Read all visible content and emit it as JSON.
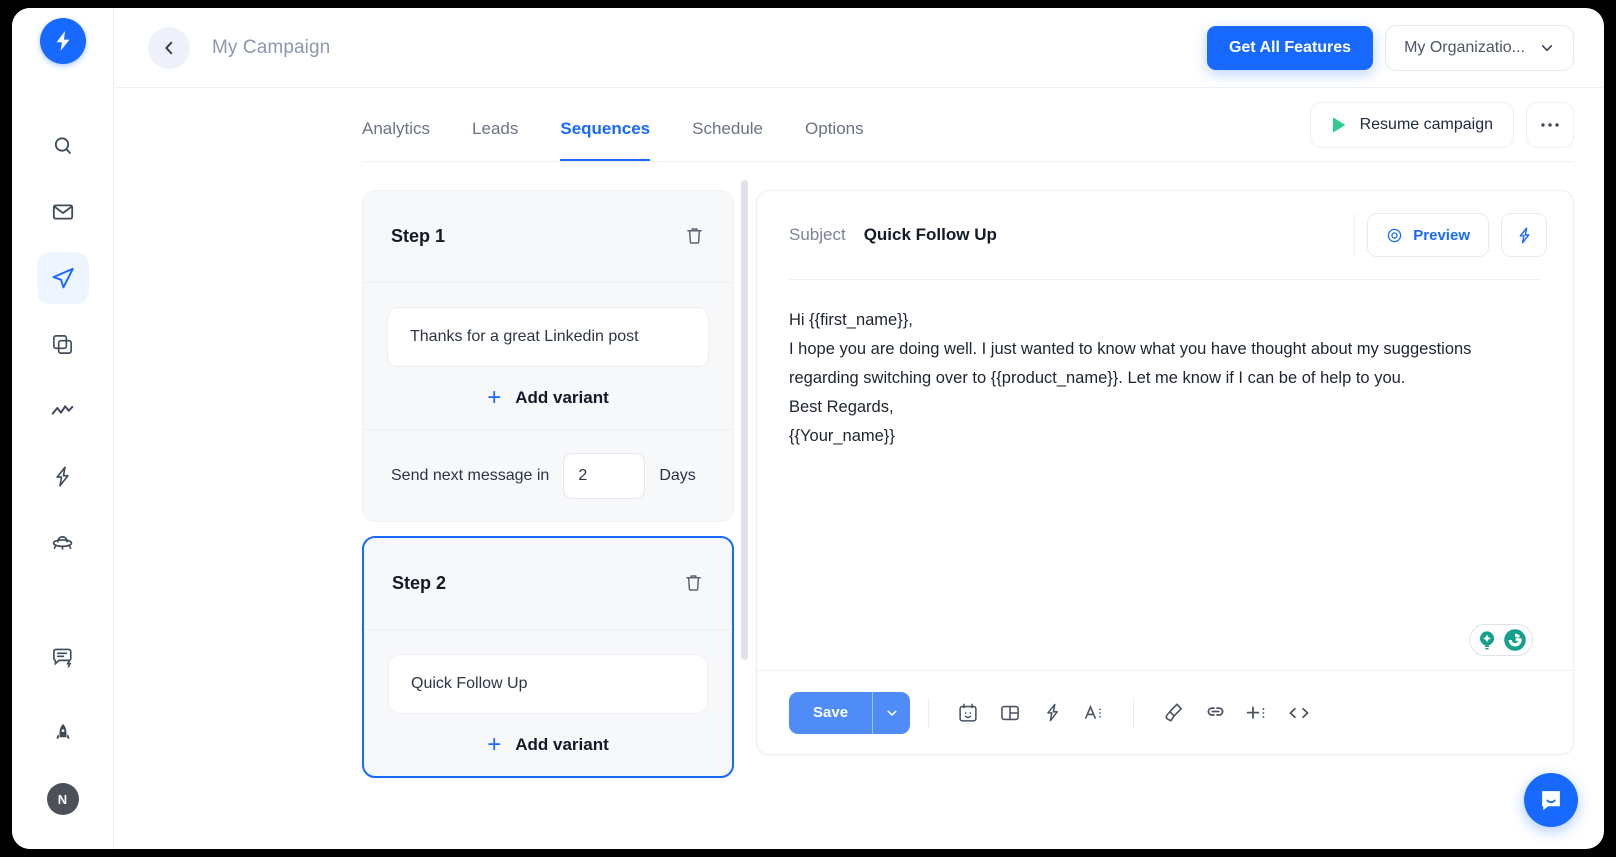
{
  "sidebar": {
    "logo_icon": "lightning-bolt-logo",
    "items": [
      {
        "icon": "search-icon",
        "name": "search",
        "active": false
      },
      {
        "icon": "mail-icon",
        "name": "inbox",
        "active": false
      },
      {
        "icon": "paper-plane-icon",
        "name": "campaigns",
        "active": true
      },
      {
        "icon": "copy-stack-icon",
        "name": "templates",
        "active": false
      },
      {
        "icon": "analytics-line-icon",
        "name": "analytics",
        "active": false
      },
      {
        "icon": "lightning-icon",
        "name": "automations",
        "active": false
      },
      {
        "icon": "ufo-icon",
        "name": "leads-finder",
        "active": false
      }
    ],
    "bottom_items": [
      {
        "icon": "chat-ai-icon",
        "name": "support-chat"
      },
      {
        "icon": "rocket-icon",
        "name": "whats-new"
      }
    ],
    "avatar_initial": "N"
  },
  "topbar": {
    "back_icon": "chevron-left-icon",
    "campaign_title": "My Campaign",
    "get_all_features_label": "Get All Features",
    "organization_label": "My Organizatio...",
    "organization_caret_icon": "chevron-down-icon"
  },
  "tabs": {
    "items": [
      {
        "label": "Analytics",
        "active": false
      },
      {
        "label": "Leads",
        "active": false
      },
      {
        "label": "Sequences",
        "active": true
      },
      {
        "label": "Schedule",
        "active": false
      },
      {
        "label": "Options",
        "active": false
      }
    ],
    "resume_label": "Resume campaign",
    "resume_icon": "play-triangle-icon",
    "more_icon": "ellipsis-horizontal-icon"
  },
  "steps": [
    {
      "title": "Step 1",
      "delete_icon": "trash-icon",
      "variants": [
        "Thanks for a great Linkedin post"
      ],
      "add_variant_label": "Add variant",
      "delay_label": "Send next message in",
      "delay_value": "2",
      "delay_unit": "Days",
      "selected": false
    },
    {
      "title": "Step 2",
      "delete_icon": "trash-icon",
      "variants": [
        "Quick Follow Up"
      ],
      "add_variant_label": "Add variant",
      "selected": true
    }
  ],
  "editor": {
    "subject_label": "Subject",
    "subject_value": "Quick Follow Up",
    "preview_label": "Preview",
    "preview_icon": "eye-target-icon",
    "spark_icon": "lightning-icon",
    "body_lines": [
      "Hi {{first_name}},",
      "I hope you are doing well. I just wanted to know what you have thought about my suggestions regarding switching over to {{product_name}}. Let me know if I can be of help to you.",
      "Best Regards,",
      "{{Your_name}}"
    ],
    "grammarly": {
      "bulb_icon": "lightbulb-icon",
      "logo_icon": "grammarly-g-icon"
    },
    "toolbar": {
      "save_label": "Save",
      "save_caret_icon": "chevron-down-icon",
      "icons": [
        "emoji-calendar-icon",
        "layout-grid-icon",
        "lightning-icon",
        "font-size-icon",
        "clean-brush-icon",
        "link-icon",
        "insert-variable-icon",
        "code-brackets-icon"
      ]
    }
  },
  "intercom": {
    "icon": "chat-smile-icon"
  },
  "colors": {
    "brand_blue": "#1769ff",
    "green": "#2ecc8f",
    "grammarly_teal": "#15a08a",
    "panel_grey": "#f7f8fa"
  }
}
